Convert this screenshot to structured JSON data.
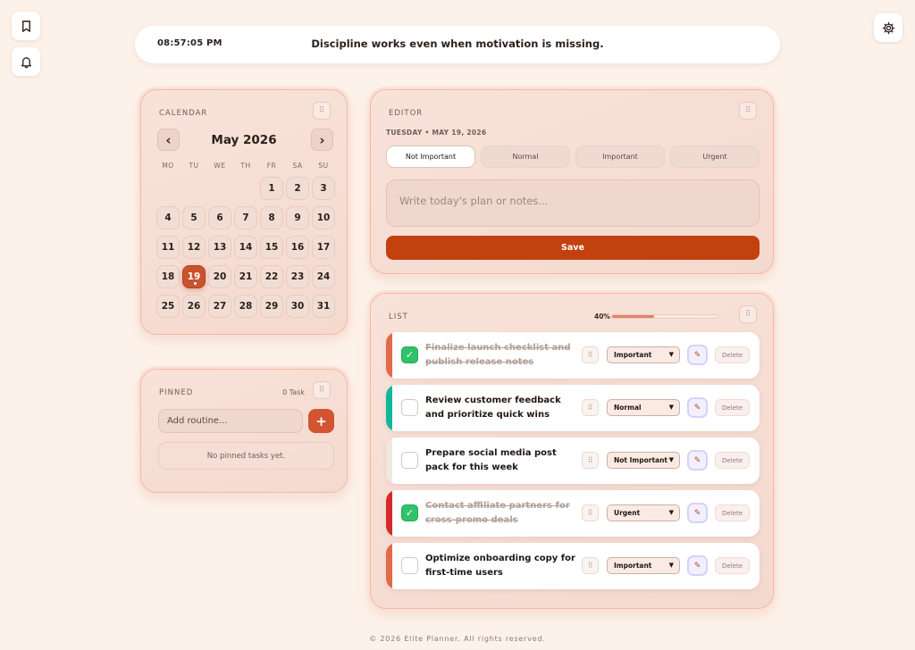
{
  "topbar": {
    "time": "08:57:05 PM",
    "quote": "Discipline works even when motivation is missing."
  },
  "side": {
    "bookmark_icon": "bookmark-icon",
    "bell_icon": "bell-icon",
    "settings_icon": "gear-icon"
  },
  "calendar": {
    "title": "CALENDAR",
    "month": "May 2026",
    "prev": "‹",
    "next": "›",
    "weekdays": [
      "MO",
      "TU",
      "WE",
      "TH",
      "FR",
      "SA",
      "SU"
    ],
    "selected_day": "19",
    "weeks": [
      [
        "",
        "",
        "",
        "",
        "1",
        "2",
        "3"
      ],
      [
        "4",
        "5",
        "6",
        "7",
        "8",
        "9",
        "10"
      ],
      [
        "11",
        "12",
        "13",
        "14",
        "15",
        "16",
        "17"
      ],
      [
        "18",
        "19",
        "20",
        "21",
        "22",
        "23",
        "24"
      ],
      [
        "25",
        "26",
        "27",
        "28",
        "29",
        "30",
        "31"
      ]
    ]
  },
  "pinned": {
    "title": "PINNED",
    "count": "0 Task",
    "input_placeholder": "Add routine...",
    "add_label": "+",
    "empty_text": "No pinned tasks yet."
  },
  "editor": {
    "title": "EDITOR",
    "date": "TUESDAY • MAY 19, 2026",
    "priorities": [
      "Not Important",
      "Normal",
      "Important",
      "Urgent"
    ],
    "active_priority": "Not Important",
    "notes_placeholder": "Write today's plan or notes...",
    "save_label": "Save"
  },
  "list": {
    "title": "LIST",
    "progress_label": "40%",
    "progress": 0.4,
    "edit_glyph": "✎",
    "delete_label": "Delete",
    "tasks": [
      {
        "text": "Finalize launch checklist and publish release notes",
        "done": true,
        "priority": "Important",
        "color": "#e2694a"
      },
      {
        "text": "Review customer feedback and prioritize quick wins",
        "done": false,
        "priority": "Normal",
        "color": "#10b89a"
      },
      {
        "text": "Prepare social media post pack for this week",
        "done": false,
        "priority": "Not Important",
        "color": "#f0e7e3"
      },
      {
        "text": "Contact affiliate partners for cross-promo deals",
        "done": true,
        "priority": "Urgent",
        "color": "#d42a2a"
      },
      {
        "text": "Optimize onboarding copy for first-time users",
        "done": false,
        "priority": "Important",
        "color": "#e2694a"
      }
    ]
  },
  "footer": {
    "text": "© 2026 Elite Planner. All rights reserved."
  }
}
